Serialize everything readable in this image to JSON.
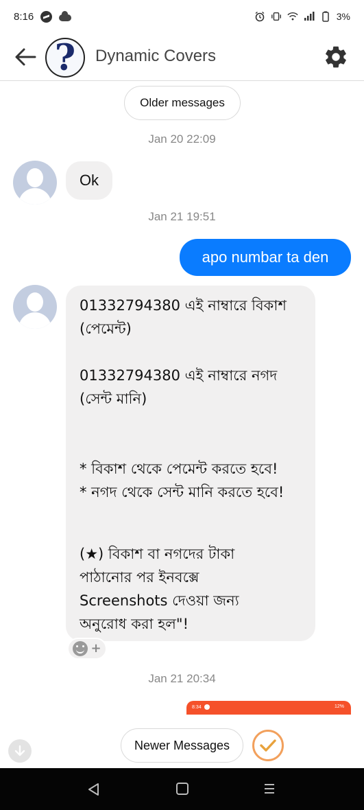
{
  "status_bar": {
    "time": "8:16",
    "battery": "3%",
    "icons": [
      "messenger-icon",
      "cloud-icon",
      "alarm-icon",
      "vibrate-icon",
      "wifi-icon",
      "signal-icon",
      "battery-icon"
    ]
  },
  "header": {
    "title": "Dynamic Covers",
    "avatar_glyph": "?",
    "icons": [
      "back-arrow-icon",
      "gear-icon"
    ]
  },
  "chat": {
    "older_label": "Older messages",
    "newer_label": "Newer Messages",
    "timestamps": [
      "Jan 20 22:09",
      "Jan 21 19:51",
      "Jan 21 20:34"
    ],
    "messages": {
      "ok": "Ok",
      "apo": "apo numbar ta den",
      "long_lines": [
        "01332794380 এই নাম্বারে বিকাশ",
        "(পেমেন্ট)",
        "01332794380 এই নাম্বারে নগদ",
        "(সেন্ট মানি)",
        "* বিকাশ থেকে পেমেন্ট করতে হবে!",
        "* নগদ থেকে সেন্ট মানি করতে হবে!",
        "(★) বিকাশ বা নগদের টাকা",
        "পাঠানোর পর ইনবক্সে",
        "Screenshots দেওয়া জন্য",
        "অনুরোধ করা হল\"!"
      ]
    },
    "reaction_plus": "+",
    "image_preview": {
      "time": "8:34",
      "status": "12%"
    }
  },
  "colors": {
    "outgoing_bubble": "#0a7cff",
    "incoming_bubble": "#f1f0f0",
    "preview_bar": "#f5512a",
    "nav_bar": "#050505"
  }
}
